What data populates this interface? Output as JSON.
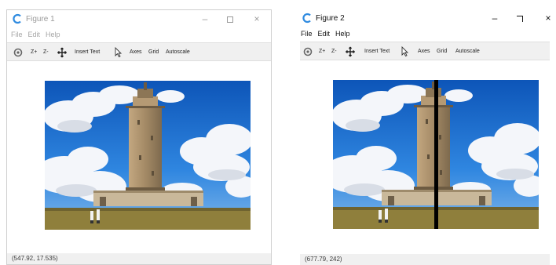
{
  "colors": {
    "chrome": "#f0f0f0",
    "sky": "#1f6fd2",
    "cloud": "#f4f6fa",
    "tower": "#a28866",
    "grass": "#8f7f3c",
    "divider": "#000000",
    "inactive_text": "#9a9a9a",
    "active_text": "#111111"
  },
  "windows": [
    {
      "title": "Figure 1",
      "active": false,
      "controls": {
        "minimize": "–",
        "close": "×"
      },
      "menu": [
        "File",
        "Edit",
        "Help"
      ],
      "toolbar": [
        {
          "icon": "home-icon"
        },
        {
          "label": "Z+"
        },
        {
          "label": "Z-"
        },
        {
          "icon": "pan-icon"
        },
        {
          "label": "Insert Text"
        },
        {
          "icon": "pointer-icon"
        },
        {
          "label": "Axes"
        },
        {
          "label": "Grid"
        },
        {
          "label": "Autoscale"
        }
      ],
      "status": "(547.92, 17.535)",
      "image": "lighthouse-photo"
    },
    {
      "title": "Figure 2",
      "active": true,
      "controls": {
        "minimize": "–",
        "close": "×"
      },
      "menu": [
        "File",
        "Edit",
        "Help"
      ],
      "toolbar": [
        {
          "icon": "home-icon"
        },
        {
          "label": "Z+"
        },
        {
          "label": "Z-"
        },
        {
          "icon": "pan-icon"
        },
        {
          "label": "Insert Text"
        },
        {
          "icon": "pointer-icon"
        },
        {
          "label": "Axes"
        },
        {
          "label": "Grid"
        },
        {
          "label": "Autoscale"
        }
      ],
      "status": "(677.79, 242)",
      "image": "mirrored-lighthouse-photo"
    }
  ]
}
